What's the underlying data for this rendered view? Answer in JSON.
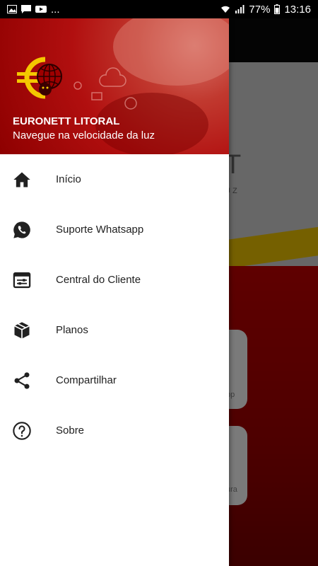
{
  "status_bar": {
    "notifications": "...",
    "battery": "77%",
    "time": "13:16"
  },
  "drawer": {
    "header": {
      "title": "EURONETT LITORAL",
      "subtitle": "Navegue na velocidade da luz"
    },
    "items": [
      {
        "label": "Início",
        "icon": "home-icon"
      },
      {
        "label": "Suporte Whatsapp",
        "icon": "whatsapp-icon"
      },
      {
        "label": "Central do Cliente",
        "icon": "customer-center-icon"
      },
      {
        "label": "Planos",
        "icon": "box-icon"
      },
      {
        "label": "Compartilhar",
        "icon": "share-icon"
      },
      {
        "label": "Sobre",
        "icon": "help-circle-icon"
      }
    ]
  },
  "background_app": {
    "logo_text": "T",
    "logo_sub": "UZ",
    "card1_label": "pp",
    "card2_label": "ura"
  },
  "colors": {
    "brand_red": "#b10f0f",
    "accent_yellow": "#f4c800"
  }
}
